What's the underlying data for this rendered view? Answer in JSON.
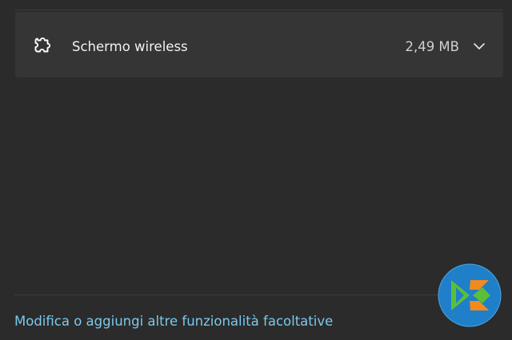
{
  "feature": {
    "name": "Schermo wireless",
    "size": "2,49 MB",
    "icon": "puzzle-icon",
    "expand_icon": "chevron-down-icon"
  },
  "footer": {
    "link_text": "Modifica o aggiungi altre funzionalità facoltative"
  },
  "logo": {
    "icon": "watermark-logo",
    "colors": {
      "background": "#1f7fc9",
      "green": "#5bbf3a",
      "orange": "#f28a1e"
    }
  },
  "theme": {
    "background": "#2b2b2b",
    "card": "#353535",
    "link": "#7cc8ec",
    "text": "#f2f2f2"
  }
}
